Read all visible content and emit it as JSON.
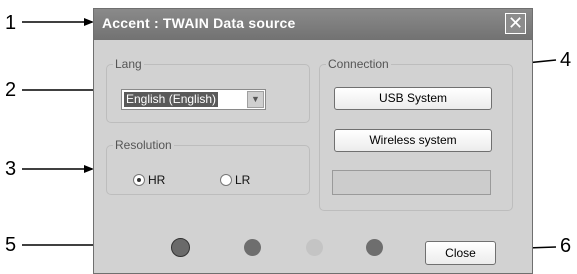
{
  "callouts": [
    "1",
    "2",
    "3",
    "4",
    "5",
    "6"
  ],
  "window": {
    "title": "Accent : TWAIN Data source",
    "close_glyph": "✕"
  },
  "lang": {
    "legend": "Lang",
    "selected": "English (English)",
    "arrow_glyph": "▼"
  },
  "resolution": {
    "legend": "Resolution",
    "options": [
      {
        "label": "HR",
        "selected": true
      },
      {
        "label": "LR",
        "selected": false
      }
    ]
  },
  "connection": {
    "legend": "Connection",
    "usb_label": "USB System",
    "wireless_label": "Wireless system",
    "status_value": ""
  },
  "indicators": [
    {
      "name": "indicator-1",
      "color": "#6a6a6a",
      "outlined": true
    },
    {
      "name": "indicator-2",
      "color": "#6e6e6e",
      "outlined": false
    },
    {
      "name": "indicator-3",
      "color": "#c4c4c4",
      "outlined": false
    },
    {
      "name": "indicator-4",
      "color": "#6e6e6e",
      "outlined": false
    }
  ],
  "footer": {
    "close_label": "Close"
  }
}
